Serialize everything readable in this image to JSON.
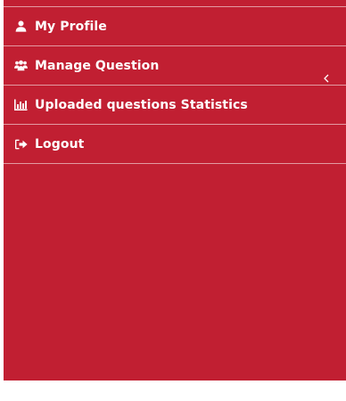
{
  "sidebar": {
    "background_color": "#c11f32",
    "text_color": "#ffffff",
    "items": [
      {
        "label": "My Profile",
        "icon": "user-icon"
      },
      {
        "label": "Manage Question",
        "icon": "users-icon"
      },
      {
        "label": "Uploaded questions Statistics",
        "icon": "bar-chart-icon"
      },
      {
        "label": "Logout",
        "icon": "sign-out-icon"
      }
    ],
    "collapse_icon": "chevron-left-icon"
  }
}
